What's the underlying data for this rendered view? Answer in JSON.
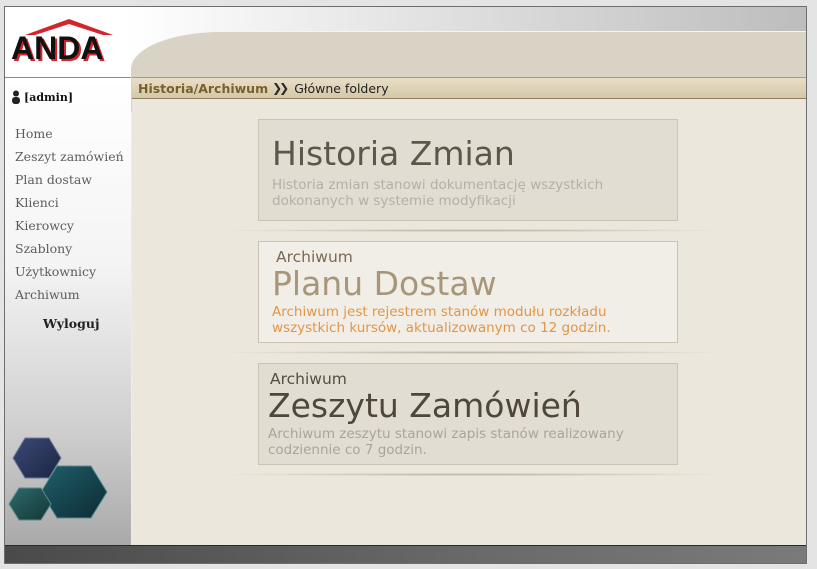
{
  "logo": {
    "text": "ANDA"
  },
  "user": {
    "label": "[admin]"
  },
  "nav": {
    "items": [
      {
        "label": "Home"
      },
      {
        "label": "Zeszyt zamówień"
      },
      {
        "label": "Plan dostaw"
      },
      {
        "label": "Klienci"
      },
      {
        "label": "Kierowcy"
      },
      {
        "label": "Szablony"
      },
      {
        "label": "Użytkownicy"
      },
      {
        "label": "Archiwum"
      }
    ],
    "logout": "Wyloguj"
  },
  "breadcrumb": {
    "link": "Historia/Archiwum",
    "separator": "❯❯",
    "current": "Główne foldery"
  },
  "cards": [
    {
      "title": "Historia Zmian",
      "description": "Historia zmian stanowi dokumentację wszystkich dokonanych w systemie modyfikacji"
    },
    {
      "pre": "Archiwum",
      "title": "Planu Dostaw",
      "description": "Archiwum jest rejestrem stanów modułu rozkładu wszystkich kursów, aktualizowanym co 12 godzin."
    },
    {
      "pre": "Archiwum",
      "title": "Zeszytu Zamówień",
      "description": "Archiwum zeszytu stanowi zapis stanów realizowany codziennie co 7 godzin."
    }
  ],
  "colors": {
    "accent": "#7a5f2a",
    "logo_red": "#d0262c",
    "card_highlight": "#e29548"
  }
}
